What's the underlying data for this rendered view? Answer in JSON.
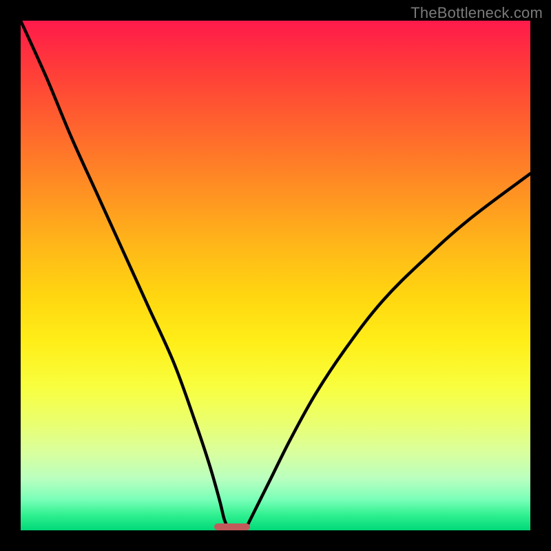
{
  "watermark": "TheBottleneck.com",
  "colors": {
    "frame": "#000000",
    "curve": "#000000",
    "marker": "#c15a5a",
    "gradient_top": "#ff1a4b",
    "gradient_bottom": "#00d878"
  },
  "chart_data": {
    "type": "line",
    "title": "",
    "xlabel": "",
    "ylabel": "",
    "xlim": [
      0,
      100
    ],
    "ylim": [
      0,
      100
    ],
    "grid": false,
    "legend": false,
    "marker": {
      "x_start": 38,
      "x_end": 45,
      "y": 0
    },
    "series": [
      {
        "name": "left-curve",
        "x": [
          0,
          5,
          10,
          15,
          20,
          25,
          30,
          34,
          37,
          39,
          40,
          41
        ],
        "y": [
          100,
          89,
          77,
          66,
          55,
          44,
          33,
          22,
          13,
          6,
          2,
          0
        ]
      },
      {
        "name": "right-curve",
        "x": [
          44,
          46,
          49,
          53,
          58,
          64,
          71,
          79,
          88,
          100
        ],
        "y": [
          0,
          4,
          10,
          18,
          27,
          36,
          45,
          53,
          61,
          70
        ]
      }
    ]
  }
}
